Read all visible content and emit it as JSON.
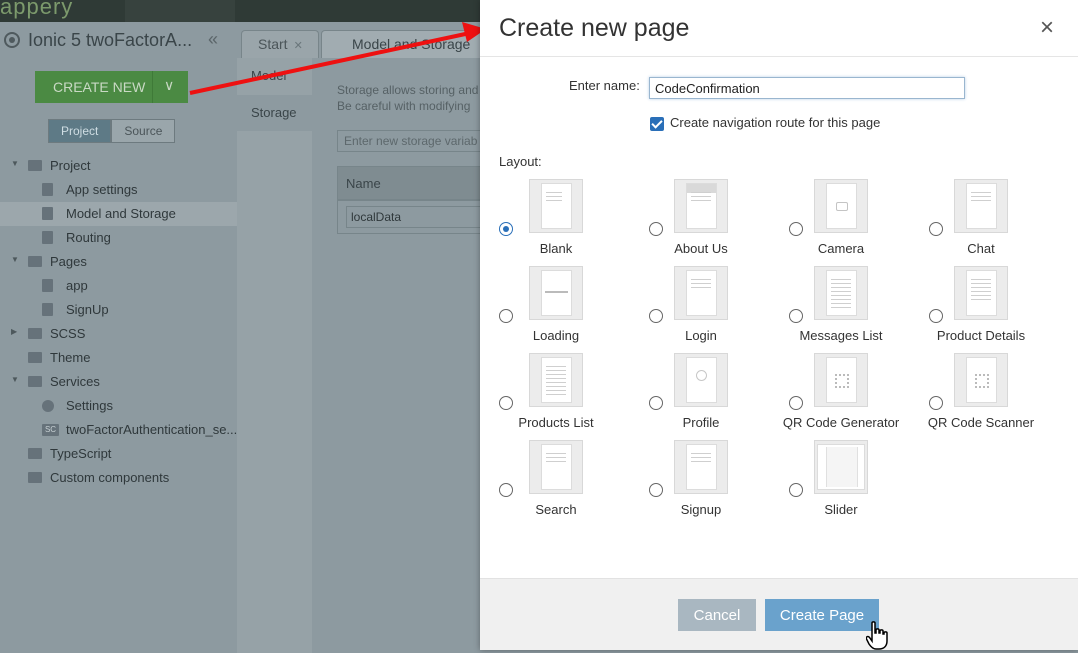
{
  "background": {
    "project_title": "Ionic 5 twoFactorA...",
    "create_new_label": "CREATE NEW",
    "panel_tabs": [
      "Project",
      "Source"
    ],
    "tree": [
      {
        "label": "Project",
        "level": 0,
        "expanded": true,
        "icon": "folder-icon"
      },
      {
        "label": "App settings",
        "level": 1,
        "icon": "settings-doc-icon"
      },
      {
        "label": "Model and Storage",
        "level": 1,
        "icon": "settings-doc-icon",
        "selected": true
      },
      {
        "label": "Routing",
        "level": 1,
        "icon": "settings-doc-icon"
      },
      {
        "label": "Pages",
        "level": 0,
        "expanded": true,
        "icon": "folder-icon"
      },
      {
        "label": "app",
        "level": 1,
        "icon": "page-icon"
      },
      {
        "label": "SignUp",
        "level": 1,
        "icon": "page-icon"
      },
      {
        "label": "SCSS",
        "level": 0,
        "expanded": false,
        "icon": "folder-icon"
      },
      {
        "label": "Theme",
        "level": 0,
        "icon": "folder-icon"
      },
      {
        "label": "Services",
        "level": 0,
        "expanded": true,
        "icon": "folder-icon"
      },
      {
        "label": "Settings",
        "level": 1,
        "icon": "gear-icon"
      },
      {
        "label": "twoFactorAuthentication_se...",
        "level": 1,
        "icon": "sc-icon"
      },
      {
        "label": "TypeScript",
        "level": 0,
        "icon": "folder-icon"
      },
      {
        "label": "Custom components",
        "level": 0,
        "icon": "folder-icon"
      }
    ],
    "content_tabs": [
      "Start",
      "Model and Storage"
    ],
    "subnav": [
      "Model",
      "Storage"
    ],
    "description_lines": [
      "Storage allows storing and",
      "Be careful with modifying"
    ],
    "storage_placeholder": "Enter new storage variab",
    "table_header": "Name",
    "table_value": "localData"
  },
  "modal": {
    "title": "Create new page",
    "close_symbol": "×",
    "name_label": "Enter name:",
    "name_value": "CodeConfirmation",
    "nav_route_label": "Create navigation route for this page",
    "nav_route_checked": true,
    "layout_label": "Layout:",
    "layouts": [
      {
        "label": "Blank",
        "selected": true
      },
      {
        "label": "About Us"
      },
      {
        "label": "Camera"
      },
      {
        "label": "Chat"
      },
      {
        "label": "Loading"
      },
      {
        "label": "Login"
      },
      {
        "label": "Messages List"
      },
      {
        "label": "Product Details"
      },
      {
        "label": "Products List"
      },
      {
        "label": "Profile"
      },
      {
        "label": "QR Code Generator"
      },
      {
        "label": "QR Code Scanner"
      },
      {
        "label": "Search"
      },
      {
        "label": "Signup"
      },
      {
        "label": "Slider"
      }
    ],
    "cancel_label": "Cancel",
    "create_label": "Create Page"
  },
  "colors": {
    "primary": "#6aa2cc",
    "radio_checked": "#2a6fb8",
    "create_new_green": "#4b8a43",
    "annotation_arrow": "#ee1111"
  }
}
